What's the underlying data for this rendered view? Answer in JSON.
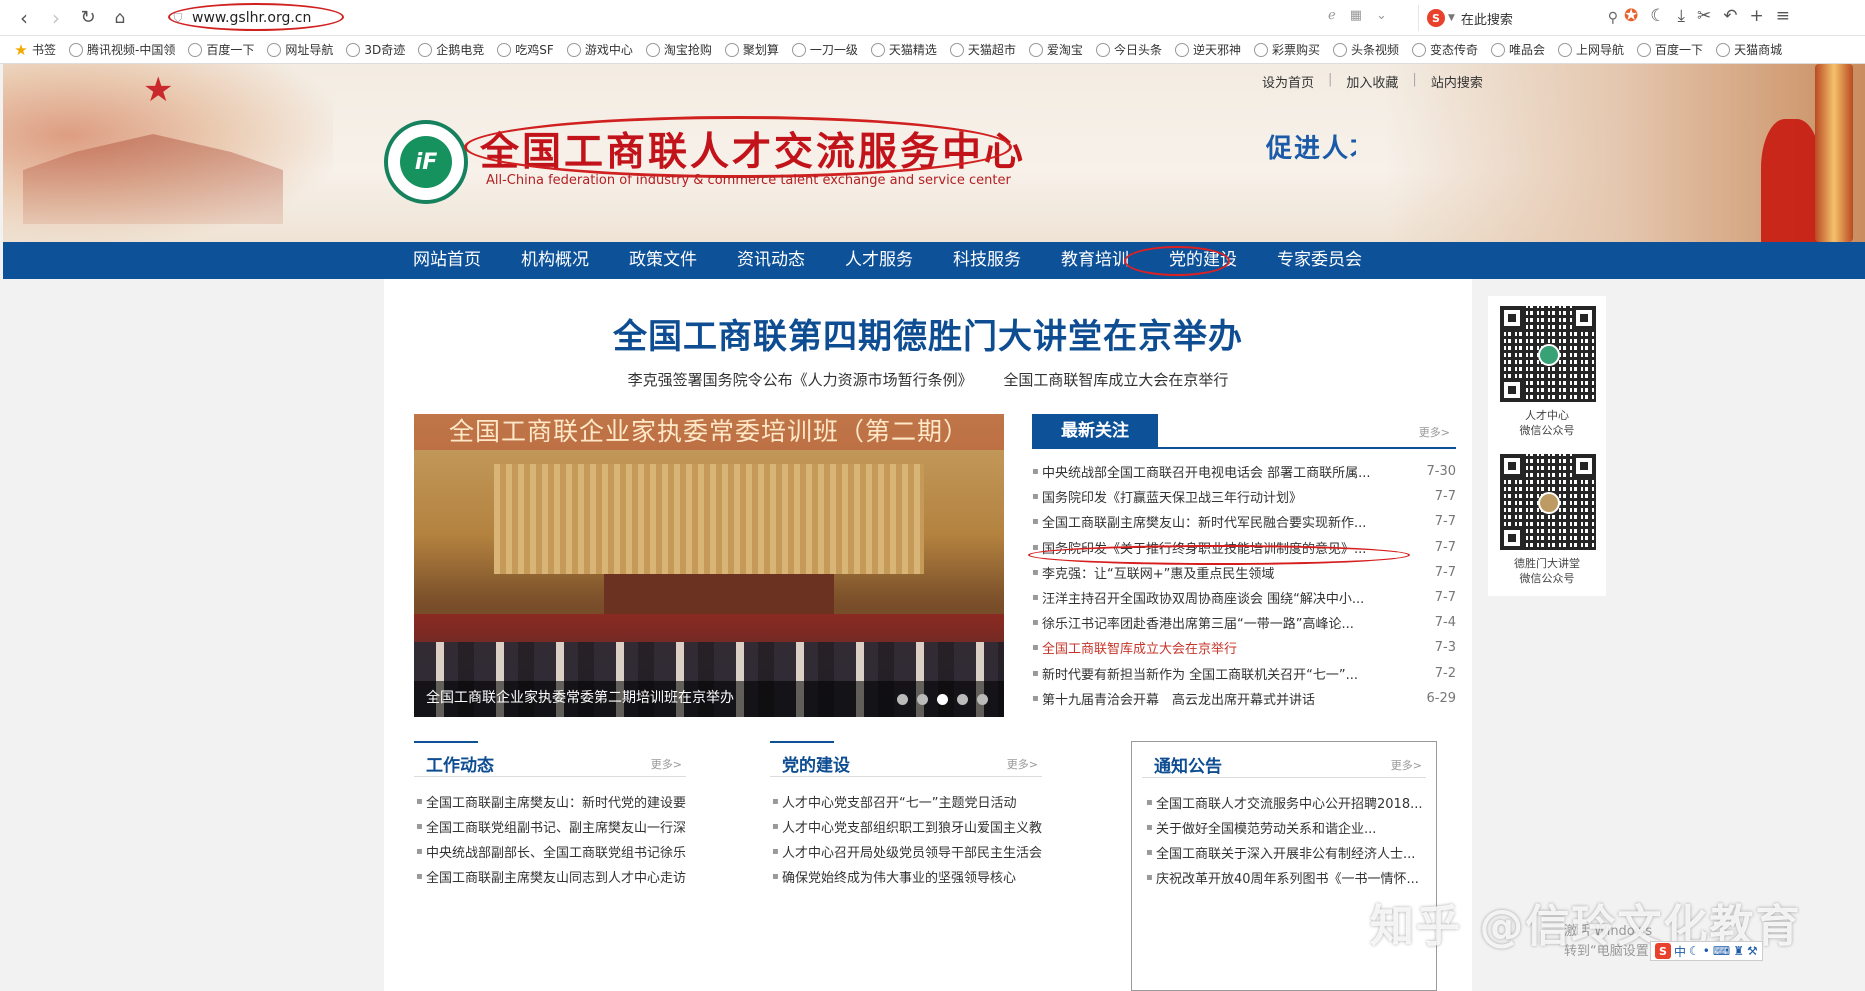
{
  "browser": {
    "url": "www.gslhr.org.cn",
    "search_placeholder": "在此搜索",
    "bookmarks": [
      "书签",
      "腾讯视频-中国领",
      "百度一下",
      "网址导航",
      "3D奇迹",
      "企鹅电竞",
      "吃鸡SF",
      "游戏中心",
      "淘宝抢购",
      "聚划算",
      "一刀一级",
      "天猫精选",
      "天猫超市",
      "爱淘宝",
      "今日头条",
      "逆天邪神",
      "彩票购买",
      "头条视频",
      "变态传奇",
      "唯品会",
      "上网导航",
      "百度一下",
      "天猫商城"
    ]
  },
  "header": {
    "site_title": "全国工商联人才交流服务中心",
    "site_title_en": "All-China federation of industry & commerce talent exchange and service center",
    "slogan": "促进人才",
    "logo_mark": "iF",
    "top_links": [
      "设为首页",
      "加入收藏",
      "站内搜索"
    ]
  },
  "nav": [
    "网站首页",
    "机构概况",
    "政策文件",
    "资讯动态",
    "人才服务",
    "科技服务",
    "教育培训",
    "党的建设",
    "专家委员会"
  ],
  "headline": {
    "title": "全国工商联第四期德胜门大讲堂在京举办",
    "sub1": "李克强签署国务院令公布《人力资源市场暂行条例》",
    "sub2": "全国工商联智库成立大会在京举行"
  },
  "slider": {
    "banner_text": "全国工商联企业家执委常委培训班（第二期）",
    "caption": "全国工商联企业家执委常委第二期培训班在京举办",
    "dot_count": 5,
    "active_dot": 3
  },
  "latest": {
    "title": "最新关注",
    "more": "更多>",
    "items": [
      {
        "title": "中央统战部全国工商联召开电视电话会 部署工商联所属...",
        "date": "7-30"
      },
      {
        "title": "国务院印发《打赢蓝天保卫战三年行动计划》",
        "date": "7-7"
      },
      {
        "title": "全国工商联副主席樊友山：新时代军民融合要实现新作...",
        "date": "7-7"
      },
      {
        "title": "国务院印发《关于推行终身职业技能培训制度的意见》...",
        "date": "7-7"
      },
      {
        "title": "李克强：让“互联网+”惠及重点民生领域",
        "date": "7-7"
      },
      {
        "title": "汪洋主持召开全国政协双周协商座谈会 围绕“解决中小...",
        "date": "7-7"
      },
      {
        "title": "徐乐江书记率团赴香港出席第三届“一带一路”高峰论...",
        "date": "7-4"
      },
      {
        "title": "全国工商联智库成立大会在京举行",
        "date": "7-3"
      },
      {
        "title": "新时代要有新担当新作为 全国工商联机关召开“七一”...",
        "date": "7-2"
      },
      {
        "title": "第十九届青洽会开幕　高云龙出席开幕式并讲话",
        "date": "6-29"
      }
    ]
  },
  "panels": {
    "work": {
      "title": "工作动态",
      "more": "更多>",
      "items": [
        "全国工商联副主席樊友山：新时代党的建设要...",
        "全国工商联党组副书记、副主席樊友山一行深...",
        "中央统战部副部长、全国工商联党组书记徐乐...",
        "全国工商联副主席樊友山同志到人才中心走访..."
      ]
    },
    "party": {
      "title": "党的建设",
      "more": "更多>",
      "items": [
        "人才中心党支部召开“七一”主题党日活动",
        "人才中心党支部组织职工到狼牙山爱国主义教...",
        "人才中心召开局处级党员领导干部民主生活会...",
        "确保党始终成为伟大事业的坚强领导核心"
      ]
    },
    "notice": {
      "title": "通知公告",
      "more": "更多>",
      "items": [
        "全国工商联人才交流服务中心公开招聘2018...",
        "关于做好全国模范劳动关系和谐企业...",
        "全国工商联关于深入开展非公有制经济人士...",
        "庆祝改革开放40周年系列图书《一书一情怀..."
      ]
    }
  },
  "qr": {
    "first_label_1": "人才中心",
    "first_label_2": "微信公众号",
    "second_label_1": "德胜门大讲堂",
    "second_label_2": "微信公众号"
  },
  "overlay": {
    "watermark": "知乎 @信玲文化教育",
    "activate_1": "激活 Windows",
    "activate_2": "转到“电脑设置”以激活 Windows。",
    "ime_label": "中"
  },
  "colors": {
    "nav_blue": "#0d5199",
    "title_red": "#c2131a",
    "headline_blue": "#0e4d92",
    "highlight_ring": "#d12020"
  }
}
